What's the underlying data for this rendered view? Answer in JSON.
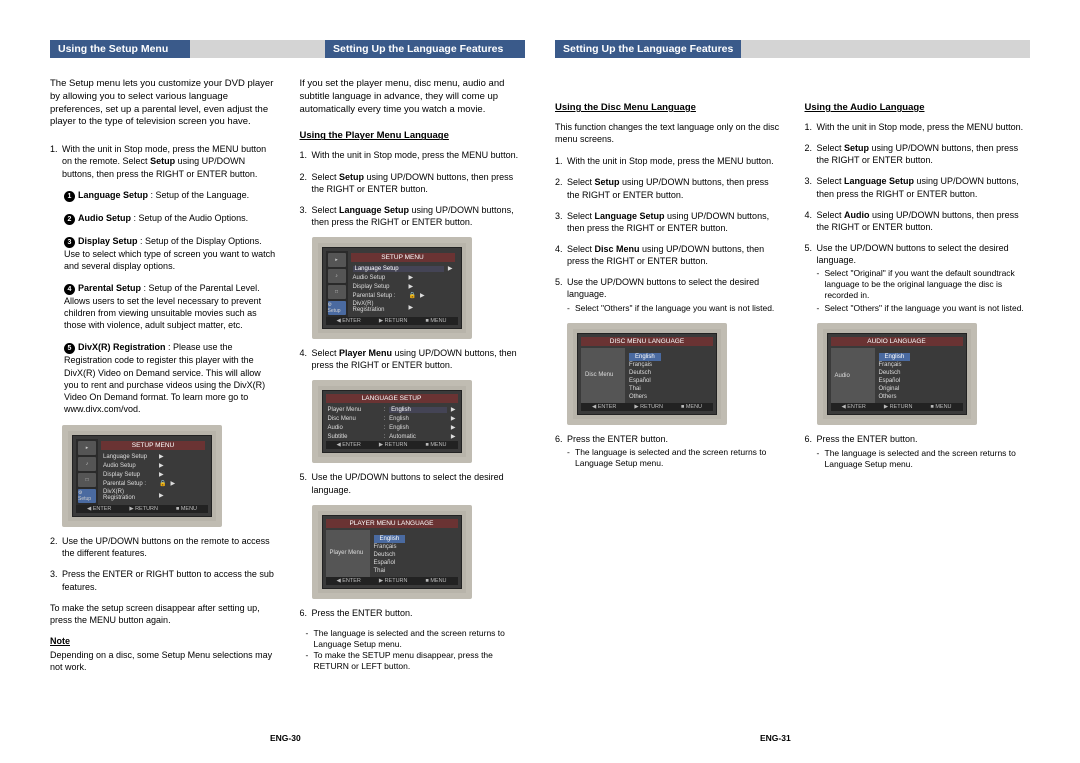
{
  "headers": {
    "setup_menu": "Using the Setup Menu",
    "lang_features": "Setting Up the Language Features"
  },
  "left": {
    "col1": {
      "intro": "The Setup menu lets you customize your DVD player by allowing you to select various language preferences, set up a parental level, even adjust the player to the type of television screen you have.",
      "step1": "With the unit in Stop mode, press the MENU button on the remote. Select Setup using UP/DOWN buttons, then press the RIGHT or ENTER button.",
      "b1_t": "Language Setup",
      "b1_d": " : Setup of the Language.",
      "b2_t": "Audio Setup",
      "b2_d": " : Setup of the Audio Options.",
      "b3_t": "Display Setup",
      "b3_d": " : Setup of the Display Options. Use to select which type of screen you want to watch and several display options.",
      "b4_t": "Parental Setup",
      "b4_d": " : Setup of the Parental Level. Allows users to set the level necessary to prevent children from viewing unsuitable movies such as those with violence, adult subject matter, etc.",
      "b5_t": "DivX(R) Registration",
      "b5_d": " : Please use the Registration code to register this player with the DivX(R) Video on Demand service.\nThis will allow you to rent and purchase videos using the DivX(R) Video On Demand format. To learn more go to www.divx.com/vod.",
      "step2": "Use the UP/DOWN buttons on the remote to access the different features.",
      "step3": "Press the ENTER or RIGHT button to access the sub features.",
      "closing": "To make the setup screen disappear after setting up, press the MENU button again.",
      "note_label": "Note",
      "note_body": "Depending on a disc, some Setup Menu selections may not work."
    },
    "col2": {
      "intro": "If you set the player menu, disc menu, audio and subtitle language in advance, they will come up automatically every time you watch a movie.",
      "subhead": "Using the Player Menu Language",
      "s1": "With the unit in Stop mode, press the MENU button.",
      "s2": "Select Setup using UP/DOWN buttons, then press the RIGHT or ENTER button.",
      "s3": "Select Language Setup using UP/DOWN buttons, then press the RIGHT or ENTER button.",
      "s4": "Select Player Menu using UP/DOWN buttons, then press the RIGHT or ENTER button.",
      "s5": "Use the UP/DOWN buttons to select the desired language.",
      "s6": "Press the ENTER button.",
      "n1": "The language is selected and the screen returns to Language Setup menu.",
      "n2": "To make the SETUP menu disappear, press the RETURN or LEFT button."
    }
  },
  "right": {
    "col1": {
      "subhead": "Using the Disc Menu Language",
      "intro": "This function changes the text language only on the disc menu screens.",
      "s1": "With the unit in Stop mode, press the MENU button.",
      "s2": "Select Setup using UP/DOWN buttons, then press the RIGHT or ENTER button.",
      "s3": "Select Language Setup using UP/DOWN buttons, then press the RIGHT or ENTER button.",
      "s4": "Select Disc Menu using UP/DOWN buttons, then press the RIGHT or ENTER button.",
      "s5": "Use the UP/DOWN buttons to select the desired language.",
      "s5n": "Select \"Others\" if the language you want is not listed.",
      "s6": "Press the ENTER button.",
      "s6n": "The language is selected and the screen returns to Language Setup menu."
    },
    "col2": {
      "subhead": "Using the Audio Language",
      "s1": "With the unit in Stop mode, press the MENU button.",
      "s2": "Select Setup using UP/DOWN buttons, then press the RIGHT or ENTER button.",
      "s3": "Select Language Setup using UP/DOWN buttons, then press the RIGHT or ENTER button.",
      "s4": "Select Audio using UP/DOWN buttons, then press the RIGHT or ENTER button.",
      "s5": "Use the UP/DOWN buttons to select the desired language.",
      "s5n1": "Select \"Original\" if you want the default soundtrack language to be the original language the disc is recorded in.",
      "s5n2": "Select \"Others\" if the language you want is not listed.",
      "s6": "Press the ENTER button.",
      "s6n": "The language is selected and the screen returns to Language Setup menu."
    }
  },
  "osd": {
    "setup_title": "SETUP MENU",
    "rows": [
      "Language Setup",
      "Audio Setup",
      "Display Setup",
      "Parental Setup :",
      "DivX(R) Registration"
    ],
    "lock_icon": "🔒",
    "lang_setup_title": "LANGUAGE SETUP",
    "lang_rows": [
      "Player Menu",
      "Disc Menu",
      "Audio",
      "Subtitle"
    ],
    "lang_vals": [
      "English",
      "English",
      "English",
      "Automatic"
    ],
    "pm_title": "PLAYER MENU LANGUAGE",
    "pm_left": "Player Menu",
    "disc_title": "DISC MENU LANGUAGE",
    "disc_left": "Disc Menu",
    "audio_title": "AUDIO LANGUAGE",
    "audio_left": "Audio",
    "langs_player": [
      "English",
      "Français",
      "Deutsch",
      "Español",
      "Thai"
    ],
    "langs_disc": [
      "English",
      "Français",
      "Deutsch",
      "Español",
      "Thai",
      "Others"
    ],
    "langs_audio": [
      "English",
      "Français",
      "Deutsch",
      "Español",
      "Original",
      "Others"
    ],
    "foot": [
      "◀ ENTER",
      "▶ RETURN",
      "■ MENU"
    ]
  },
  "footer": {
    "left": "ENG-30",
    "right": "ENG-31"
  }
}
